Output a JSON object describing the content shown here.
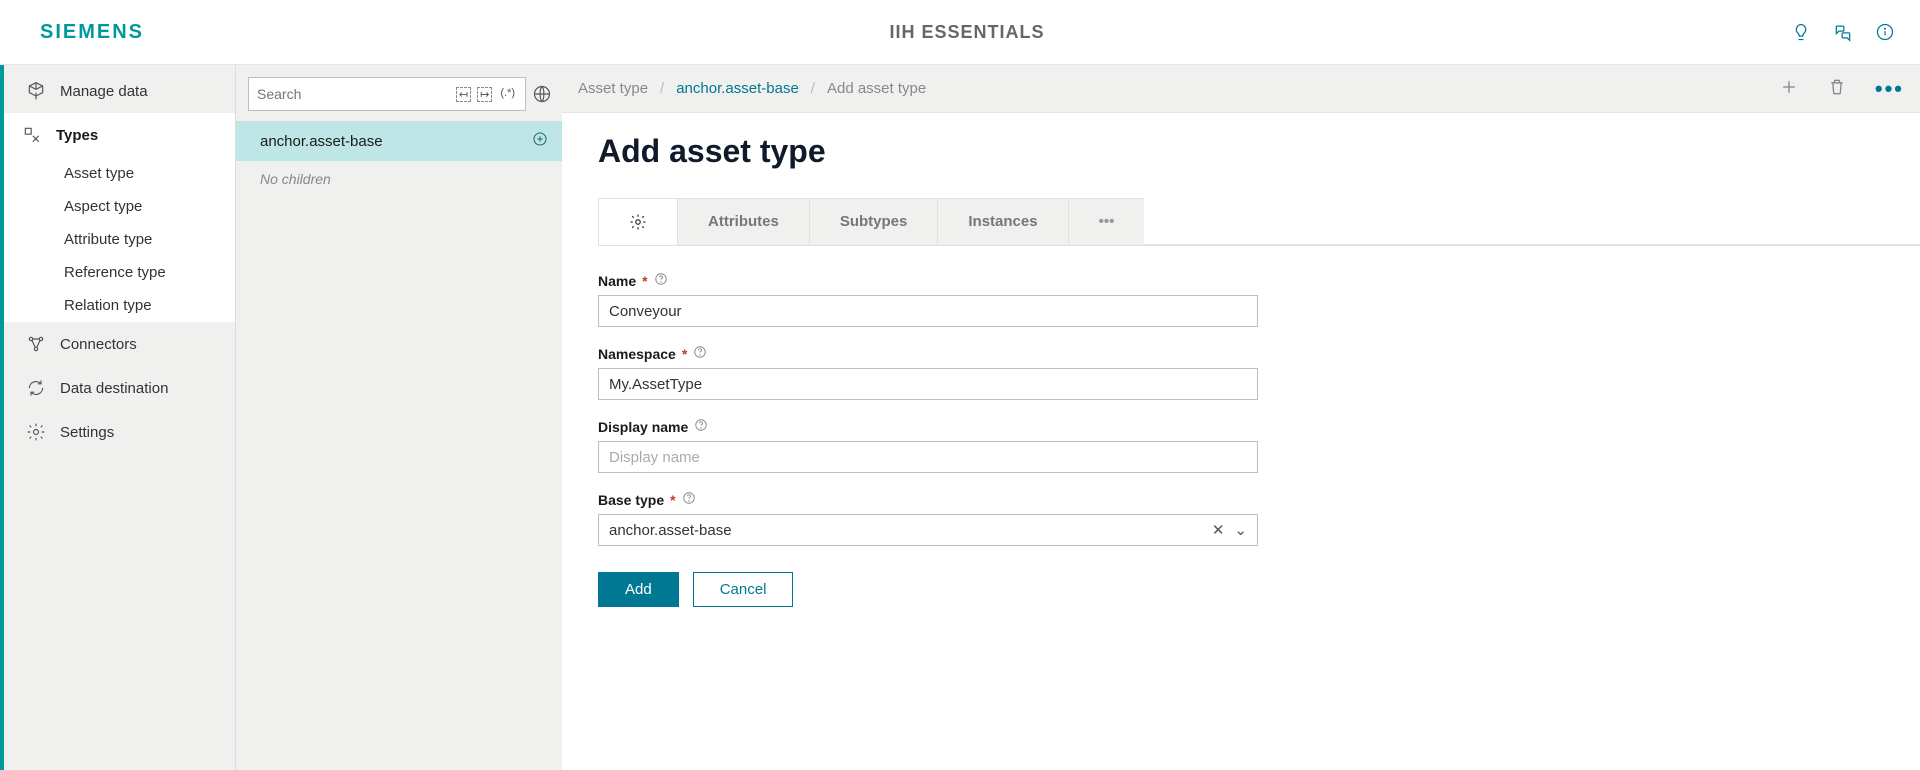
{
  "header": {
    "logo": "SIEMENS",
    "app_title": "IIH ESSENTIALS"
  },
  "sidebar": {
    "manage_data": "Manage data",
    "types": "Types",
    "sub": {
      "asset_type": "Asset type",
      "aspect_type": "Aspect type",
      "attribute_type": "Attribute type",
      "reference_type": "Reference type",
      "relation_type": "Relation type"
    },
    "connectors": "Connectors",
    "data_destination": "Data destination",
    "settings": "Settings"
  },
  "tree": {
    "search_placeholder": "Search",
    "node": "anchor.asset-base",
    "no_children": "No children"
  },
  "breadcrumb": {
    "root": "Asset type",
    "parent": "anchor.asset-base",
    "current": "Add asset type"
  },
  "page": {
    "title": "Add asset type",
    "tabs": {
      "attributes": "Attributes",
      "subtypes": "Subtypes",
      "instances": "Instances"
    }
  },
  "form": {
    "name": {
      "label": "Name",
      "value": "Conveyour"
    },
    "namespace": {
      "label": "Namespace",
      "value": "My.AssetType"
    },
    "display_name": {
      "label": "Display name",
      "placeholder": "Display name",
      "value": ""
    },
    "base_type": {
      "label": "Base type",
      "value": "anchor.asset-base"
    },
    "buttons": {
      "add": "Add",
      "cancel": "Cancel"
    }
  }
}
